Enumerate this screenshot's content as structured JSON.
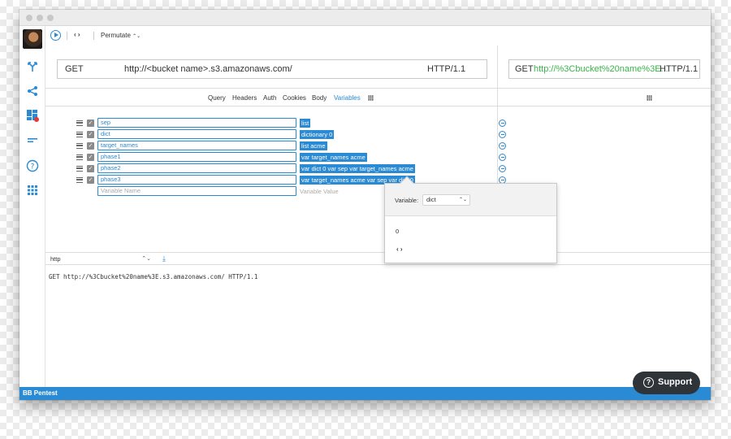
{
  "toolbar": {
    "mode_label": "Permutate",
    "mode_arrows": "⌃⌄",
    "nav_arrows": "‹ ›"
  },
  "request": {
    "method": "GET",
    "url": "http://<bucket name>.s3.amazonaws.com/",
    "protocol": "HTTP/1.1"
  },
  "output": {
    "method": "GET",
    "url": "http://%3Cbucket%20name%3E...",
    "protocol": "HTTP/1.1"
  },
  "tabs": [
    {
      "label": "Query"
    },
    {
      "label": "Headers"
    },
    {
      "label": "Auth"
    },
    {
      "label": "Cookies"
    },
    {
      "label": "Body"
    },
    {
      "label": "Variables"
    }
  ],
  "variables": [
    {
      "name": "sep",
      "value": "list"
    },
    {
      "name": "dict",
      "value": "dictionary 0"
    },
    {
      "name": "target_names",
      "value": "list acme"
    },
    {
      "name": "phase1",
      "value": "var target_names acme"
    },
    {
      "name": "phase2",
      "value": "var dict 0 var sep  var target_names acme"
    },
    {
      "name": "phase3",
      "value": "var target_names acme var sep  var dict 0"
    }
  ],
  "new_variable": {
    "name_placeholder": "Variable Name",
    "value_placeholder": "Variable Value"
  },
  "bottom": {
    "format": "http",
    "raw_request": "GET http://%3Cbucket%20name%3E.s3.amazonaws.com/ HTTP/1.1"
  },
  "popover": {
    "variable_label": "Variable:",
    "selected_variable": "dict",
    "value": "0",
    "code_glyph": "‹ ›"
  },
  "status_bar": {
    "text": "BB Pentest"
  },
  "support": {
    "label": "Support"
  },
  "colors": {
    "accent": "#2a8ad4",
    "link_green": "#3ab44a",
    "notification": "#e53935",
    "support_bg": "#2f3438"
  },
  "icons": {
    "sidebar": [
      "fork-icon",
      "share-icon",
      "dashboard-icon",
      "filter-icon",
      "help-icon",
      "apps-grid-icon"
    ]
  }
}
